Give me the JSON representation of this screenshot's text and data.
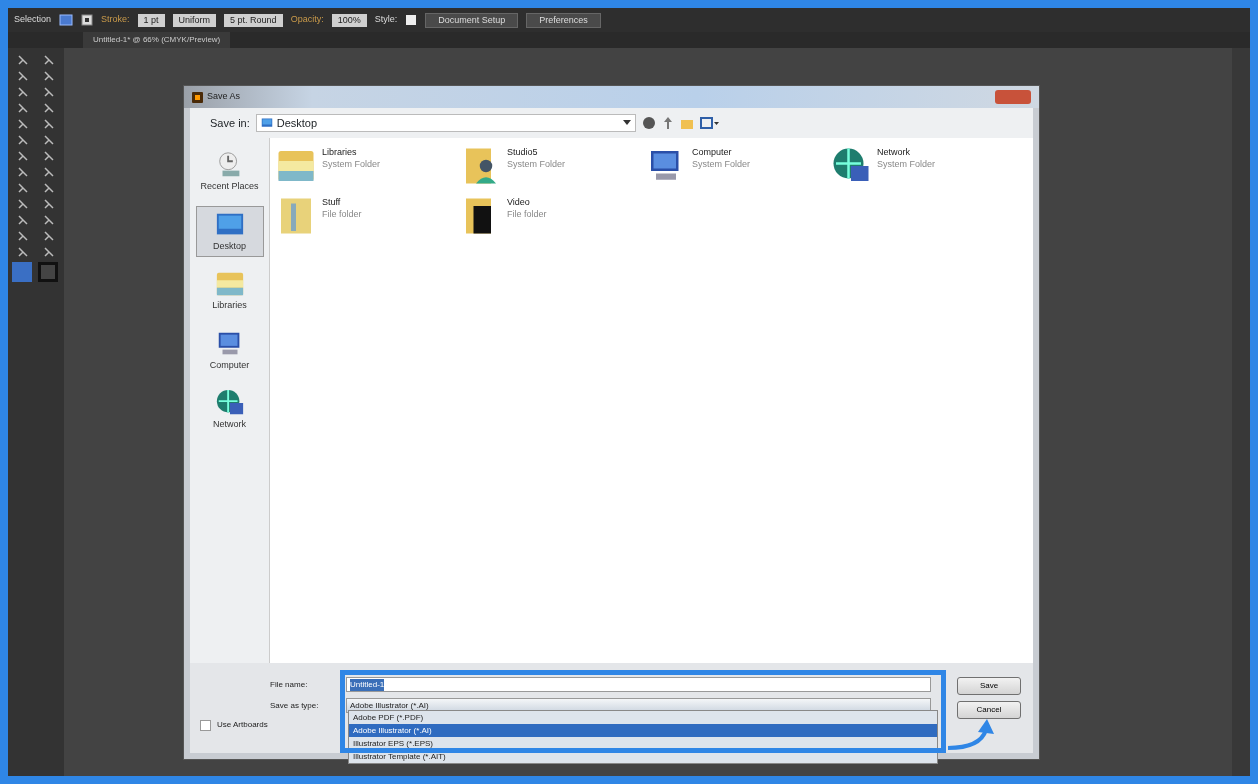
{
  "toolbar": {
    "tool_name": "Selection",
    "stroke_label": "Stroke:",
    "stroke_weight": "1 pt",
    "stroke_profile": "Uniform",
    "brush": "5 pt. Round",
    "opacity_label": "Opacity:",
    "opacity": "100%",
    "style_label": "Style:",
    "buttons": [
      "Document Setup",
      "Preferences"
    ]
  },
  "document_tab": {
    "title": "Untitled-1* @ 66% (CMYK/Preview)"
  },
  "dialog": {
    "title": "Save As",
    "save_in_label": "Save in:",
    "save_in": "Desktop",
    "places": [
      {
        "label": "Recent Places",
        "kind": "recent",
        "selected": false
      },
      {
        "label": "Desktop",
        "kind": "desktop",
        "selected": true
      },
      {
        "label": "Libraries",
        "kind": "library",
        "selected": false
      },
      {
        "label": "Computer",
        "kind": "computer",
        "selected": false
      },
      {
        "label": "Network",
        "kind": "network",
        "selected": false
      }
    ],
    "items": [
      {
        "name": "Libraries",
        "type": "System Folder",
        "kind": "library"
      },
      {
        "name": "Studio5",
        "type": "System Folder",
        "kind": "user"
      },
      {
        "name": "Computer",
        "type": "System Folder",
        "kind": "computer"
      },
      {
        "name": "Network",
        "type": "System Folder",
        "kind": "network"
      },
      {
        "name": "Stuff",
        "type": "File folder",
        "kind": "folder"
      },
      {
        "name": "Video",
        "type": "File folder",
        "kind": "video"
      }
    ],
    "file_name_label": "File name:",
    "file_name": "Untitled-1",
    "save_as_type_label": "Save as type:",
    "save_as_type": "Adobe Illustrator (*.AI)",
    "type_options": [
      {
        "label": "Adobe PDF (*.PDF)",
        "selected": false
      },
      {
        "label": "Adobe Illustrator (*.AI)",
        "selected": true
      },
      {
        "label": "Illustrator EPS (*.EPS)",
        "selected": false
      },
      {
        "label": "Illustrator Template (*.AIT)",
        "selected": false
      }
    ],
    "use_artboards": {
      "label": "Use Artboards",
      "checked": false
    },
    "buttons": [
      "Save",
      "Cancel"
    ]
  }
}
